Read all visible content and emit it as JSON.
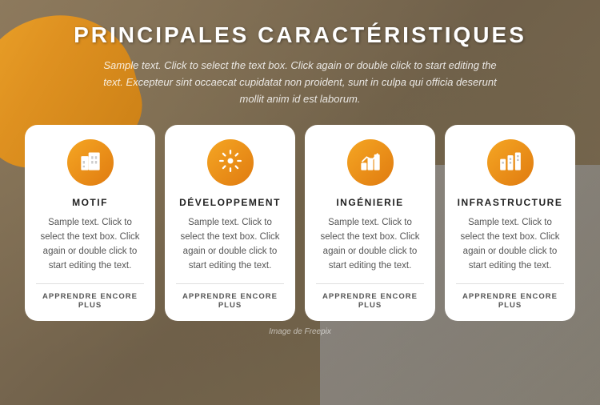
{
  "page": {
    "title": "PRINCIPALES CARACTÉRISTIQUES",
    "subtitle": "Sample text. Click to select the text box. Click again or double click to start editing the text. Excepteur sint occaecat cupidatat non proident, sunt in culpa qui officia deserunt mollit anim id est laborum.",
    "footer_credit": "Image de Freepix"
  },
  "cards": [
    {
      "id": "motif",
      "icon": "🏢",
      "title": "MOTIF",
      "text": "Sample text. Click to select the text box. Click again or double click to start editing the text.",
      "link": "APPRENDRE ENCORE PLUS"
    },
    {
      "id": "developpement",
      "icon": "⚙️",
      "title": "DÉVELOPPEMENT",
      "text": "Sample text. Click to select the text box. Click again or double click to start editing the text.",
      "link": "APPRENDRE ENCORE PLUS"
    },
    {
      "id": "ingenierie",
      "icon": "🏗️",
      "title": "INGÉNIERIE",
      "text": "Sample text. Click to select the text box. Click again or double click to start editing the text.",
      "link": "APPRENDRE ENCORE PLUS"
    },
    {
      "id": "infrastructure",
      "icon": "🏙️",
      "title": "INFRASTRUCTURE",
      "text": "Sample text. Click to select the text box. Click again or double click to start editing the text.",
      "link": "APPRENDRE ENCORE PLUS"
    }
  ],
  "colors": {
    "accent": "#f5a623",
    "accent_dark": "#e07b10"
  }
}
